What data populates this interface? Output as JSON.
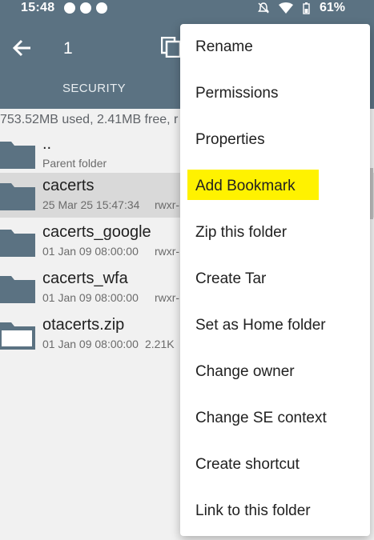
{
  "status_bar": {
    "time": "15:48",
    "battery": "61%",
    "icons": [
      "facebook-icon",
      "chrome-icon",
      "gallery-icon",
      "mute-icon",
      "wifi-icon",
      "battery-icon"
    ]
  },
  "app_bar": {
    "title": "1",
    "tab": "SECURITY",
    "background": "#5b7282"
  },
  "storage": "753.52MB used, 2.41MB free, r",
  "files": [
    {
      "name": "..",
      "meta": "Parent folder",
      "perm": "",
      "icon": "folder-icon"
    },
    {
      "name": "cacerts",
      "meta": "25 Mar 25 15:47:34",
      "perm": "rwxr-",
      "icon": "folder-icon"
    },
    {
      "name": "cacerts_google",
      "meta": "01 Jan 09 08:00:00",
      "perm": "rwxr-",
      "icon": "folder-icon"
    },
    {
      "name": "cacerts_wfa",
      "meta": "01 Jan 09 08:00:00",
      "perm": "rwxr-",
      "icon": "folder-icon"
    },
    {
      "name": "otacerts.zip",
      "meta": "01 Jan 09 08:00:00",
      "perm": "2.21K",
      "icon": "archive-icon"
    }
  ],
  "menu": {
    "items": [
      "Rename",
      "Permissions",
      "Properties",
      "Add Bookmark",
      "Zip this folder",
      "Create Tar",
      "Set as Home folder",
      "Change owner",
      "Change SE context",
      "Create shortcut",
      "Link to this folder"
    ],
    "highlight_color": "#fff200"
  }
}
